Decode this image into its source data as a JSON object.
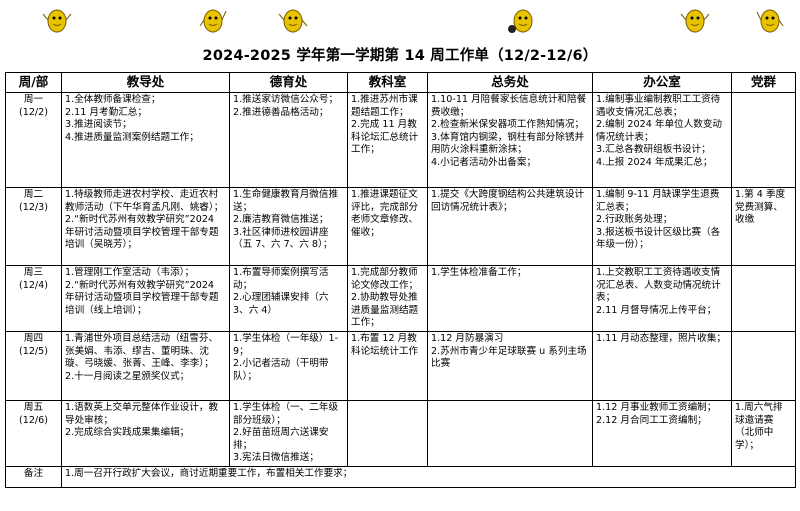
{
  "title": "2024-2025 学年第一学期第 14 周工作单（12/2-12/6）",
  "colors": {
    "mascot_body": "#e8c300",
    "mascot_outline": "#7a5a00",
    "ball": "#222222"
  },
  "mascot_icons": [
    "mascot-icon",
    "mascot-icon",
    "mascot-icon",
    "mascot-icon",
    "mascot-icon",
    "mascot-icon"
  ],
  "headers": [
    "周/部",
    "教导处",
    "德育处",
    "教科室",
    "总务处",
    "办公室",
    "党群"
  ],
  "rows": [
    {
      "day": "周一",
      "date": "(12/2)",
      "cells": [
        [
          "1.全体教师备课检查；",
          "2.11 月考勤汇总；",
          "3.推进阅读节；",
          "4.推进质量监测案例结题工作；"
        ],
        [
          "1.推送家访微信公众号；",
          "2.推进德善品格活动；"
        ],
        [
          "1.推进苏州市课题结题工作；",
          "2.完成 11 月教科论坛汇总统计工作；"
        ],
        [
          "1.10-11 月陪餐家长信息统计和陪餐费收缴；",
          "2.检查新米保安器项工作熟知情况；",
          "3.体育馆内钢梁，钢柱有部分除锈并用防火涂料重新涂抹；",
          "4.小记者活动外出备案；"
        ],
        [
          "1.编制事业编制教职工工资待遇收支情况汇总表；",
          "2.编制 2024 年单位人数变动情况统计表；",
          "3.汇总各教研组板书设计；",
          "4.上报 2024 年成果汇总；"
        ],
        []
      ]
    },
    {
      "day": "周二",
      "date": "(12/3)",
      "cells": [
        [
          "1.特级教师走进农村学校、走近农村教师活动（下午华育孟凡刚、姚睿）；",
          "2.“新时代苏州有效教学研究”2024 年研讨活动暨项目学校管理干部专题培训（吴晓芳）；"
        ],
        [
          "1.生命健康教育月微信推送；",
          "2.廉洁教育微信推送；",
          "3.社区律师进校园讲座（五 7、六 7、六 8）；"
        ],
        [
          "1.推进课题征文评比，完成部分老师文章修改、催收；"
        ],
        [
          "1.提交《大跨度钢结构公共建筑设计回访情况统计表》；"
        ],
        [
          "1.编制 9-11 月缺课学生退费汇总表；",
          "2.行政账务处理；",
          "3.报送板书设计区级比赛（各年级一份）；"
        ],
        [
          "1.第 4 季度党费测算、收缴"
        ]
      ]
    },
    {
      "day": "周三",
      "date": "(12/4)",
      "cells": [
        [
          "1.管理刚工作室活动（韦添）；",
          "2.“新时代苏州有效教学研究”2024 年研讨活动暨项目学校管理干部专题培训（线上培训）；"
        ],
        [
          "1.布置导师案例撰写活动；",
          "2.心理团辅课安排（六 3、六 4）"
        ],
        [
          "1.完成部分教师论文修改工作；",
          "2.协助教导处推进质量监测结题工作；"
        ],
        [
          "1.学生体检准备工作；"
        ],
        [
          "1.上交教职工工资待遇收支情况汇总表、人数变动情况统计表；",
          "2.11 月督导情况上传平台；"
        ],
        []
      ]
    },
    {
      "day": "周四",
      "date": "(12/5)",
      "cells": [
        [
          "1.青浦世外项目总结活动（纽雪芬、张美娟、韦添、缪吉、董明珠、沈璇、弓晓媛、张菁、王峰、李李）；",
          "2.十一月阅读之星颁奖仪式；"
        ],
        [
          "1.学生体检（一年级）1-9；",
          "2.小记者活动（干明带队）；"
        ],
        [
          "1.布置 12 月教科论坛统计工作"
        ],
        [
          "1.12 月防暴演习",
          "2.苏州市青少年足球联赛 u 系列主场比赛"
        ],
        [
          "1.11 月动态整理，照片收集；"
        ],
        []
      ]
    },
    {
      "day": "周五",
      "date": "(12/6)",
      "cells": [
        [
          "1.语数英上交单元整体作业设计，教导处审核；",
          "2.完成综合实践成果集编辑；"
        ],
        [
          "1.学生体检（一、二年级部分班级）；",
          "2.好苗苗班周六送课安排；",
          "3.宪法日微信推送；"
        ],
        [],
        [],
        [
          "1.12 月事业教师工资编制；",
          "2.12 月合同工工资编制；"
        ],
        [
          "1.周六气排球邀请赛（北师中学）；"
        ]
      ]
    }
  ],
  "note_label": "备注",
  "note_text": "1.周一召开行政扩大会议，商讨近期重要工作，布置相关工作要求；"
}
